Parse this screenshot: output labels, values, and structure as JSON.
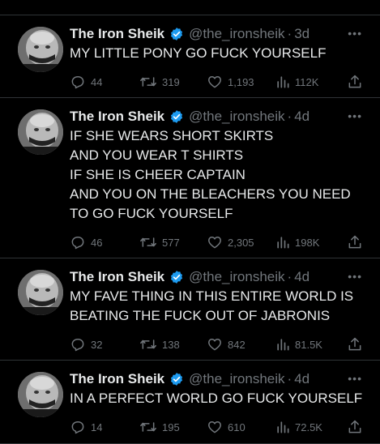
{
  "tweets": [
    {
      "name": "The Iron Sheik",
      "handle": "@the_ironsheik",
      "separator": "·",
      "time": "3d",
      "text": [
        "MY LITTLE PONY GO FUCK YOURSELF"
      ],
      "replies": "44",
      "retweets": "319",
      "likes": "1,193",
      "views": "112K"
    },
    {
      "name": "The Iron Sheik",
      "handle": "@the_ironsheik",
      "separator": "·",
      "time": "4d",
      "text": [
        "IF SHE WEARS SHORT SKIRTS",
        "AND YOU WEAR T SHIRTS",
        "IF SHE IS CHEER CAPTAIN",
        "AND YOU ON THE BLEACHERS YOU NEED",
        "TO GO FUCK YOURSELF"
      ],
      "replies": "46",
      "retweets": "577",
      "likes": "2,305",
      "views": "198K"
    },
    {
      "name": "The Iron Sheik",
      "handle": "@the_ironsheik",
      "separator": "·",
      "time": "4d",
      "text": [
        "MY FAVE THING IN THIS ENTIRE WORLD IS",
        "BEATING THE FUCK OUT OF JABRONIS"
      ],
      "replies": "32",
      "retweets": "138",
      "likes": "842",
      "views": "81.5K"
    },
    {
      "name": "The Iron Sheik",
      "handle": "@the_ironsheik",
      "separator": "·",
      "time": "4d",
      "text": [
        "IN A PERFECT WORLD GO FUCK YOURSELF"
      ],
      "replies": "14",
      "retweets": "195",
      "likes": "610",
      "views": "72.5K"
    }
  ],
  "icons": {
    "more": "more-icon",
    "reply": "reply-icon",
    "retweet": "retweet-icon",
    "like": "heart-icon",
    "views": "views-icon",
    "share": "share-icon",
    "verified": "verified-badge-icon"
  },
  "colors": {
    "background": "#000000",
    "text": "#e7e9ea",
    "muted": "#71767b",
    "verified": "#1d9bf0",
    "divider": "#2f3336"
  }
}
